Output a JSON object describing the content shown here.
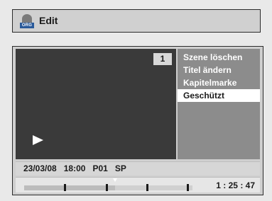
{
  "header": {
    "title": "Edit",
    "icon": "disc-org-icon",
    "icon_badge": "ORG"
  },
  "video": {
    "scene_number": "1",
    "state_icon": "play-icon"
  },
  "menu": {
    "items": [
      {
        "label": "Szene löschen",
        "selected": false
      },
      {
        "label": "Titel ändern",
        "selected": false
      },
      {
        "label": "Kapitelmarke",
        "selected": false
      },
      {
        "label": "Geschützt",
        "selected": true
      }
    ]
  },
  "info": {
    "date": "23/03/08",
    "time": "18:00",
    "program": "P01",
    "mode": "SP"
  },
  "progress": {
    "fraction": 0.54,
    "chapter_marks": [
      0.24,
      0.49,
      0.73,
      0.97
    ],
    "current_position": 0.54,
    "elapsed": "1 : 25 : 47"
  },
  "colors": {
    "menu_bg": "#8c8c8c",
    "selected_bg": "#ffffff",
    "video_bg": "#3a3a3a",
    "badge": "#2a5a9a"
  }
}
